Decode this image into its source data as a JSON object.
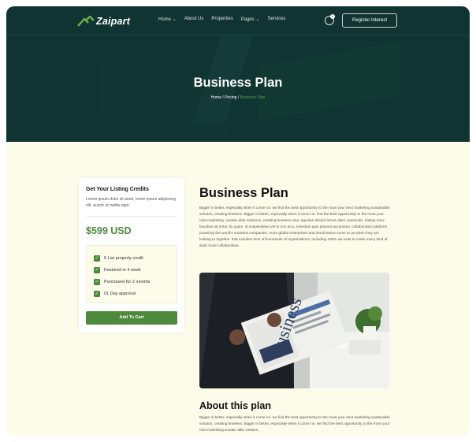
{
  "header": {
    "logo_text": "Zaipart",
    "nav": [
      "Home ⌄",
      "About Us",
      "Properties",
      "Pages ⌄",
      "Services"
    ],
    "cart_count": "0",
    "register_button": "Register Interest"
  },
  "hero": {
    "title": "Business Plan",
    "breadcrumb": {
      "home": "Home",
      "separator1": " / ",
      "pricing": "Pricing",
      "separator2": " / ",
      "current": "Business Plan"
    }
  },
  "sidebar_card": {
    "title": "Get Your Listing Credits",
    "description": "Lorem ipsum dolor sit amet, lorem ipsum adipiscing elit. auctor ut mattis eget.",
    "price": "$599 USD",
    "features": [
      "5 List property credit",
      "Featured in 4 week",
      "Purchased for 2 months",
      "01 Day approval"
    ],
    "button": "Add To Cart"
  },
  "main": {
    "title": "Business Plan",
    "paragraph": "Bigger is better, especially when it come roi. we find the best opportunity to the most your next marketing,sustainable solution, creating timeless. Bigger is better, especially when it come roi. find the best opportunity to the most your next marketing. sustain able solutions, creating timeless struc egestas dictum lectus diam commodo. tristiqu nunc faucibus sit tortor do quam. id suspendisse vel in non arcu, interdum quis placera accumsan. collaboration platform powering the world's smartest companies. more global enterprises and small teams come to us when they are looking to together. that includes tens of thousands of organizations, including 100% we exist to make every kind of work more collaborative.",
    "photo_alt": "Business",
    "about_title": "About this plan",
    "about_paragraph": "Bigger is better, especially when it come roi. we find the best opportunity to the most your next marketing,sustainable solution, creating timeless. Bigger is better, especially when it come roi. we find the best opportunity to the most your next marketing.sustain able solution,"
  },
  "colors": {
    "hero_bg": "#103431",
    "page_bg": "#fdfbe9",
    "accent": "#4e8a3e"
  }
}
